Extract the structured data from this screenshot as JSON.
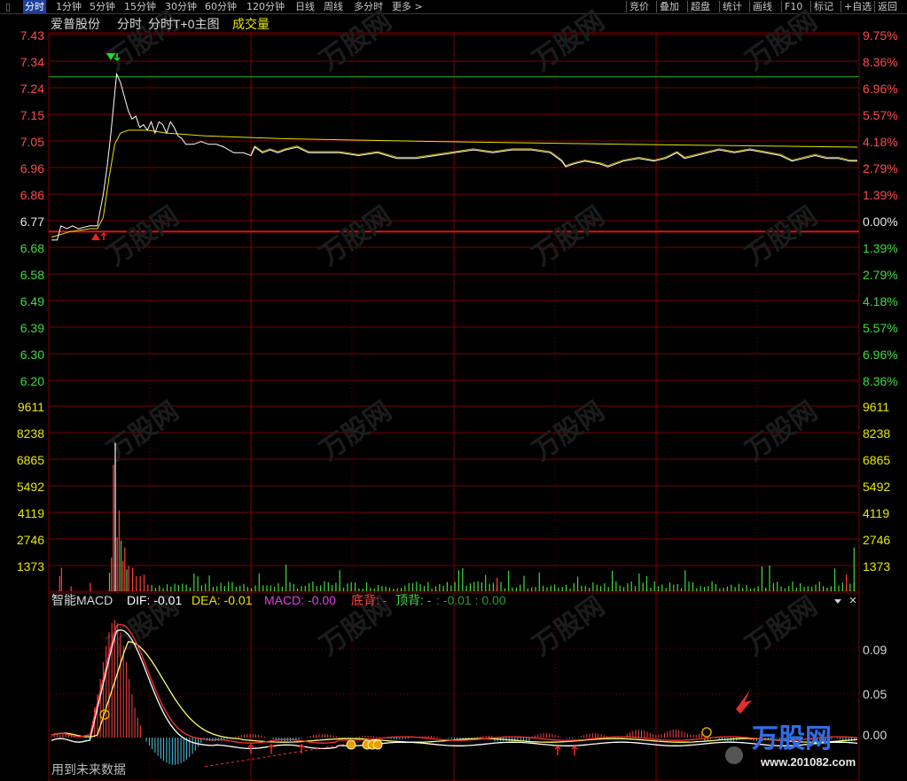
{
  "toolbar": {
    "left_tabs": [
      "分时",
      "1分钟",
      "5分钟",
      "15分钟",
      "30分钟",
      "60分钟",
      "120分钟",
      "日线",
      "周线",
      "多分时",
      "更多"
    ],
    "right_buttons": [
      "竞价",
      "叠加",
      "超盘",
      "统计",
      "画线",
      "F10",
      "标记",
      "+自选",
      "返回"
    ],
    "active": "分时"
  },
  "header": {
    "stock_name": "爱普股份",
    "chart_mode": "分时",
    "t0_label": "分时T+0主图",
    "indicator": "成交量"
  },
  "price_axis": {
    "left_labels": [
      "7.43",
      "7.34",
      "7.24",
      "7.15",
      "7.05",
      "6.96",
      "6.86",
      "6.77",
      "6.68",
      "6.58",
      "6.49",
      "6.39",
      "6.30",
      "6.20"
    ],
    "right_labels": [
      "9.75%",
      "8.36%",
      "6.96%",
      "5.57%",
      "4.18%",
      "2.79%",
      "1.39%",
      "0.00%",
      "1.39%",
      "2.79%",
      "4.18%",
      "5.57%",
      "6.96%",
      "8.36%"
    ],
    "prev_close": 6.77,
    "range": [
      6.15,
      7.47
    ]
  },
  "volume_axis": {
    "labels": [
      "9611",
      "8238",
      "6865",
      "5492",
      "4119",
      "2746",
      "1373"
    ],
    "max": 10984
  },
  "macd": {
    "title": "智能MACD",
    "dif_label": "DIF: -0.01",
    "dea_label": "DEA: -0.01",
    "macd_label": "MACD: -0.00",
    "bottom_div": "底背: -",
    "top_div": "顶背: -",
    "extra_values": ": -0.01 : 0.00",
    "axis_labels": [
      "0.09",
      "0.05",
      "0.00"
    ],
    "close_icon": "close-icon",
    "dropdown_icon": "triangle-down-icon"
  },
  "footer": {
    "future_data_note": "用到未来数据"
  },
  "watermark": {
    "brand": "万股网",
    "site": "www.201082.com"
  },
  "colors": {
    "background": "#000000",
    "grid": "#8b0000",
    "up": "#ff3232",
    "down": "#2ecc40",
    "price_line": "#ffffff",
    "avg_line": "#e6e600",
    "axis_text_up": "#ff4a4a",
    "axis_text_down": "#3ddc3d",
    "volume_axis_text": "#e8e800",
    "macd_neg": "#4fc8e8"
  },
  "chart_data": {
    "type": "line",
    "price_series_points": [
      [
        0,
        6.74
      ],
      [
        3,
        6.74
      ],
      [
        5,
        6.79
      ],
      [
        8,
        6.78
      ],
      [
        11,
        6.79
      ],
      [
        14,
        6.78
      ],
      [
        20,
        6.79
      ],
      [
        24,
        6.79
      ],
      [
        25,
        6.83
      ],
      [
        27,
        6.9
      ],
      [
        29,
        7.0
      ],
      [
        31,
        7.12
      ],
      [
        33,
        7.26
      ],
      [
        34,
        7.33
      ],
      [
        36,
        7.3
      ],
      [
        38,
        7.25
      ],
      [
        40,
        7.2
      ],
      [
        42,
        7.17
      ],
      [
        44,
        7.18
      ],
      [
        46,
        7.14
      ],
      [
        48,
        7.15
      ],
      [
        50,
        7.13
      ],
      [
        52,
        7.16
      ],
      [
        54,
        7.12
      ],
      [
        56,
        7.16
      ],
      [
        58,
        7.15
      ],
      [
        60,
        7.12
      ],
      [
        62,
        7.16
      ],
      [
        64,
        7.14
      ],
      [
        66,
        7.11
      ],
      [
        68,
        7.1
      ],
      [
        70,
        7.08
      ],
      [
        74,
        7.08
      ],
      [
        78,
        7.09
      ],
      [
        82,
        7.08
      ],
      [
        86,
        7.08
      ],
      [
        90,
        7.07
      ],
      [
        95,
        7.05
      ],
      [
        100,
        7.05
      ],
      [
        104,
        7.04
      ],
      [
        106,
        7.07
      ],
      [
        110,
        7.05
      ],
      [
        114,
        7.06
      ],
      [
        118,
        7.05
      ],
      [
        122,
        7.06
      ],
      [
        128,
        7.07
      ],
      [
        134,
        7.05
      ],
      [
        140,
        7.05
      ],
      [
        150,
        7.05
      ],
      [
        160,
        7.04
      ],
      [
        170,
        7.05
      ],
      [
        180,
        7.03
      ],
      [
        190,
        7.03
      ],
      [
        200,
        7.04
      ],
      [
        210,
        7.05
      ],
      [
        220,
        7.06
      ],
      [
        230,
        7.05
      ],
      [
        240,
        7.06
      ],
      [
        250,
        7.06
      ],
      [
        260,
        7.05
      ],
      [
        266,
        7.02
      ],
      [
        268,
        7.0
      ],
      [
        272,
        7.01
      ],
      [
        278,
        7.02
      ],
      [
        286,
        7.01
      ],
      [
        290,
        7.0
      ],
      [
        298,
        7.02
      ],
      [
        306,
        7.03
      ],
      [
        314,
        7.02
      ],
      [
        320,
        7.03
      ],
      [
        326,
        7.05
      ],
      [
        330,
        7.03
      ],
      [
        336,
        7.04
      ],
      [
        342,
        7.05
      ],
      [
        348,
        7.06
      ],
      [
        356,
        7.05
      ],
      [
        364,
        7.06
      ],
      [
        372,
        7.05
      ],
      [
        380,
        7.04
      ],
      [
        386,
        7.02
      ],
      [
        392,
        7.03
      ],
      [
        398,
        7.04
      ],
      [
        404,
        7.03
      ],
      [
        410,
        7.03
      ],
      [
        416,
        7.02
      ],
      [
        420,
        7.02
      ]
    ],
    "avg_series_points": [
      [
        0,
        6.75
      ],
      [
        10,
        6.77
      ],
      [
        20,
        6.78
      ],
      [
        24,
        6.78
      ],
      [
        27,
        6.82
      ],
      [
        30,
        6.96
      ],
      [
        33,
        7.08
      ],
      [
        36,
        7.12
      ],
      [
        40,
        7.13
      ],
      [
        50,
        7.13
      ],
      [
        60,
        7.12
      ],
      [
        80,
        7.11
      ],
      [
        120,
        7.1
      ],
      [
        200,
        7.09
      ],
      [
        300,
        7.08
      ],
      [
        420,
        7.07
      ]
    ],
    "reference_lines": [
      7.32,
      6.77
    ],
    "volume_bars_sample": [
      [
        30,
        1100
      ],
      [
        31,
        2000
      ],
      [
        32,
        7500
      ],
      [
        33,
        8800
      ],
      [
        34,
        3200
      ],
      [
        35,
        4800
      ],
      [
        36,
        3000
      ],
      [
        37,
        1800
      ],
      [
        38,
        2600
      ],
      [
        39,
        1300
      ],
      [
        40,
        1500
      ],
      [
        42,
        1400
      ],
      [
        44,
        900
      ],
      [
        46,
        900
      ],
      [
        48,
        1000
      ],
      [
        50,
        400
      ],
      [
        10,
        300
      ],
      [
        20,
        500
      ],
      [
        5,
        1400
      ],
      [
        4,
        900
      ]
    ],
    "macd_range": [
      -0.04,
      0.14
    ]
  }
}
